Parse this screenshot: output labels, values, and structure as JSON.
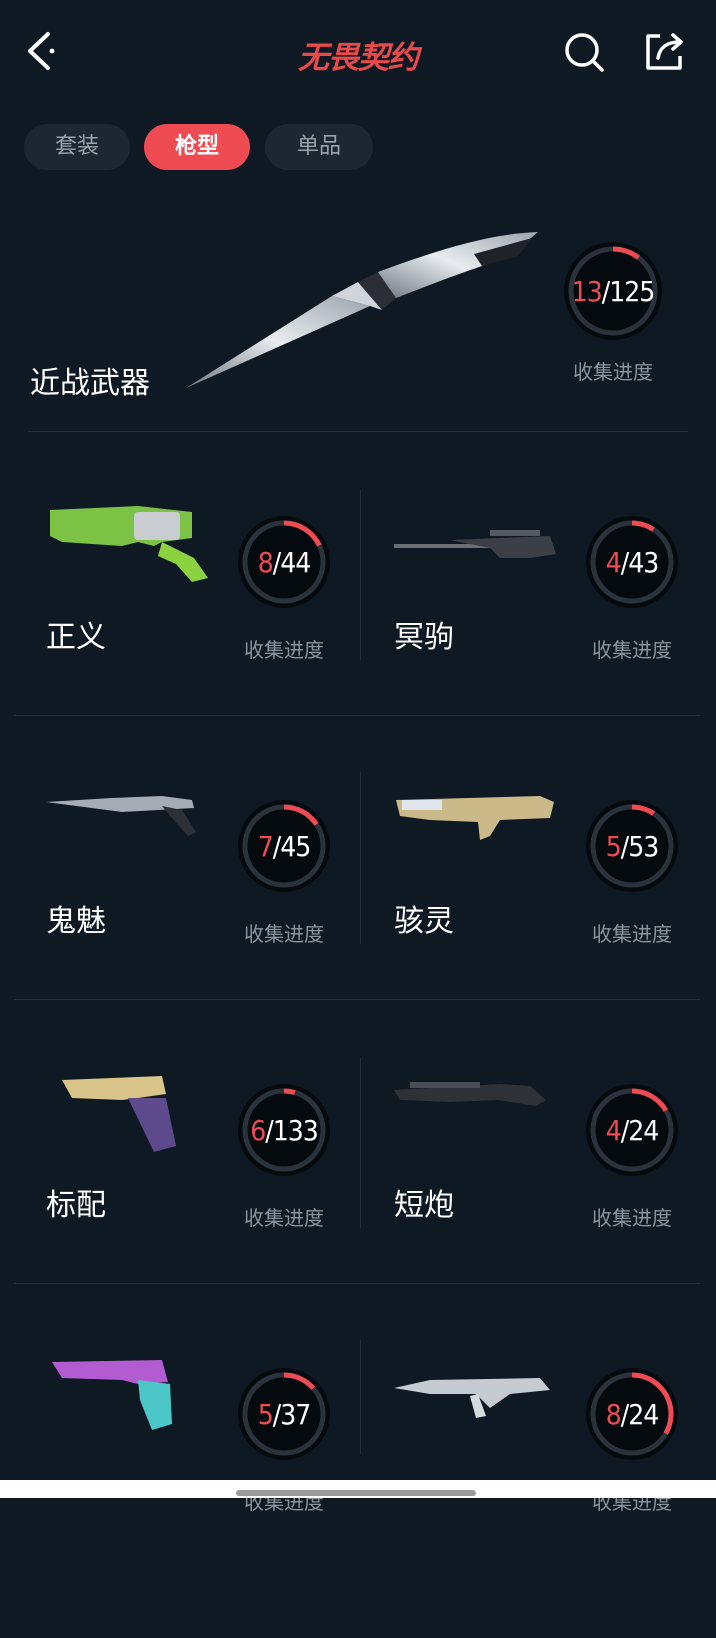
{
  "header": {
    "logo": "无畏契约",
    "back_icon": "chevron-left-icon",
    "search_icon": "search-icon",
    "share_icon": "share-icon"
  },
  "tabs": [
    {
      "label": "套装",
      "active": false
    },
    {
      "label": "枪型",
      "active": true
    },
    {
      "label": "单品",
      "active": false
    }
  ],
  "progress_label": "收集进度",
  "colors": {
    "background": "#0f1923",
    "accent": "#ef4b52",
    "ring_track": "#2a333c",
    "muted_text": "#8a939b"
  },
  "melee": {
    "name": "近战武器",
    "collected": "13",
    "total": "125",
    "progress": 0.104
  },
  "weapons": [
    {
      "name": "正义",
      "collected": "8",
      "total": "44",
      "progress": 0.18
    },
    {
      "name": "冥驹",
      "collected": "4",
      "total": "43",
      "progress": 0.093
    },
    {
      "name": "鬼魅",
      "collected": "7",
      "total": "45",
      "progress": 0.156
    },
    {
      "name": "骇灵",
      "collected": "5",
      "total": "53",
      "progress": 0.094
    },
    {
      "name": "标配",
      "collected": "6",
      "total": "133",
      "progress": 0.045
    },
    {
      "name": "短炮",
      "collected": "4",
      "total": "24",
      "progress": 0.167
    },
    {
      "name": "",
      "collected": "5",
      "total": "37",
      "progress": 0.135
    },
    {
      "name": "",
      "collected": "8",
      "total": "24",
      "progress": 0.333
    }
  ]
}
